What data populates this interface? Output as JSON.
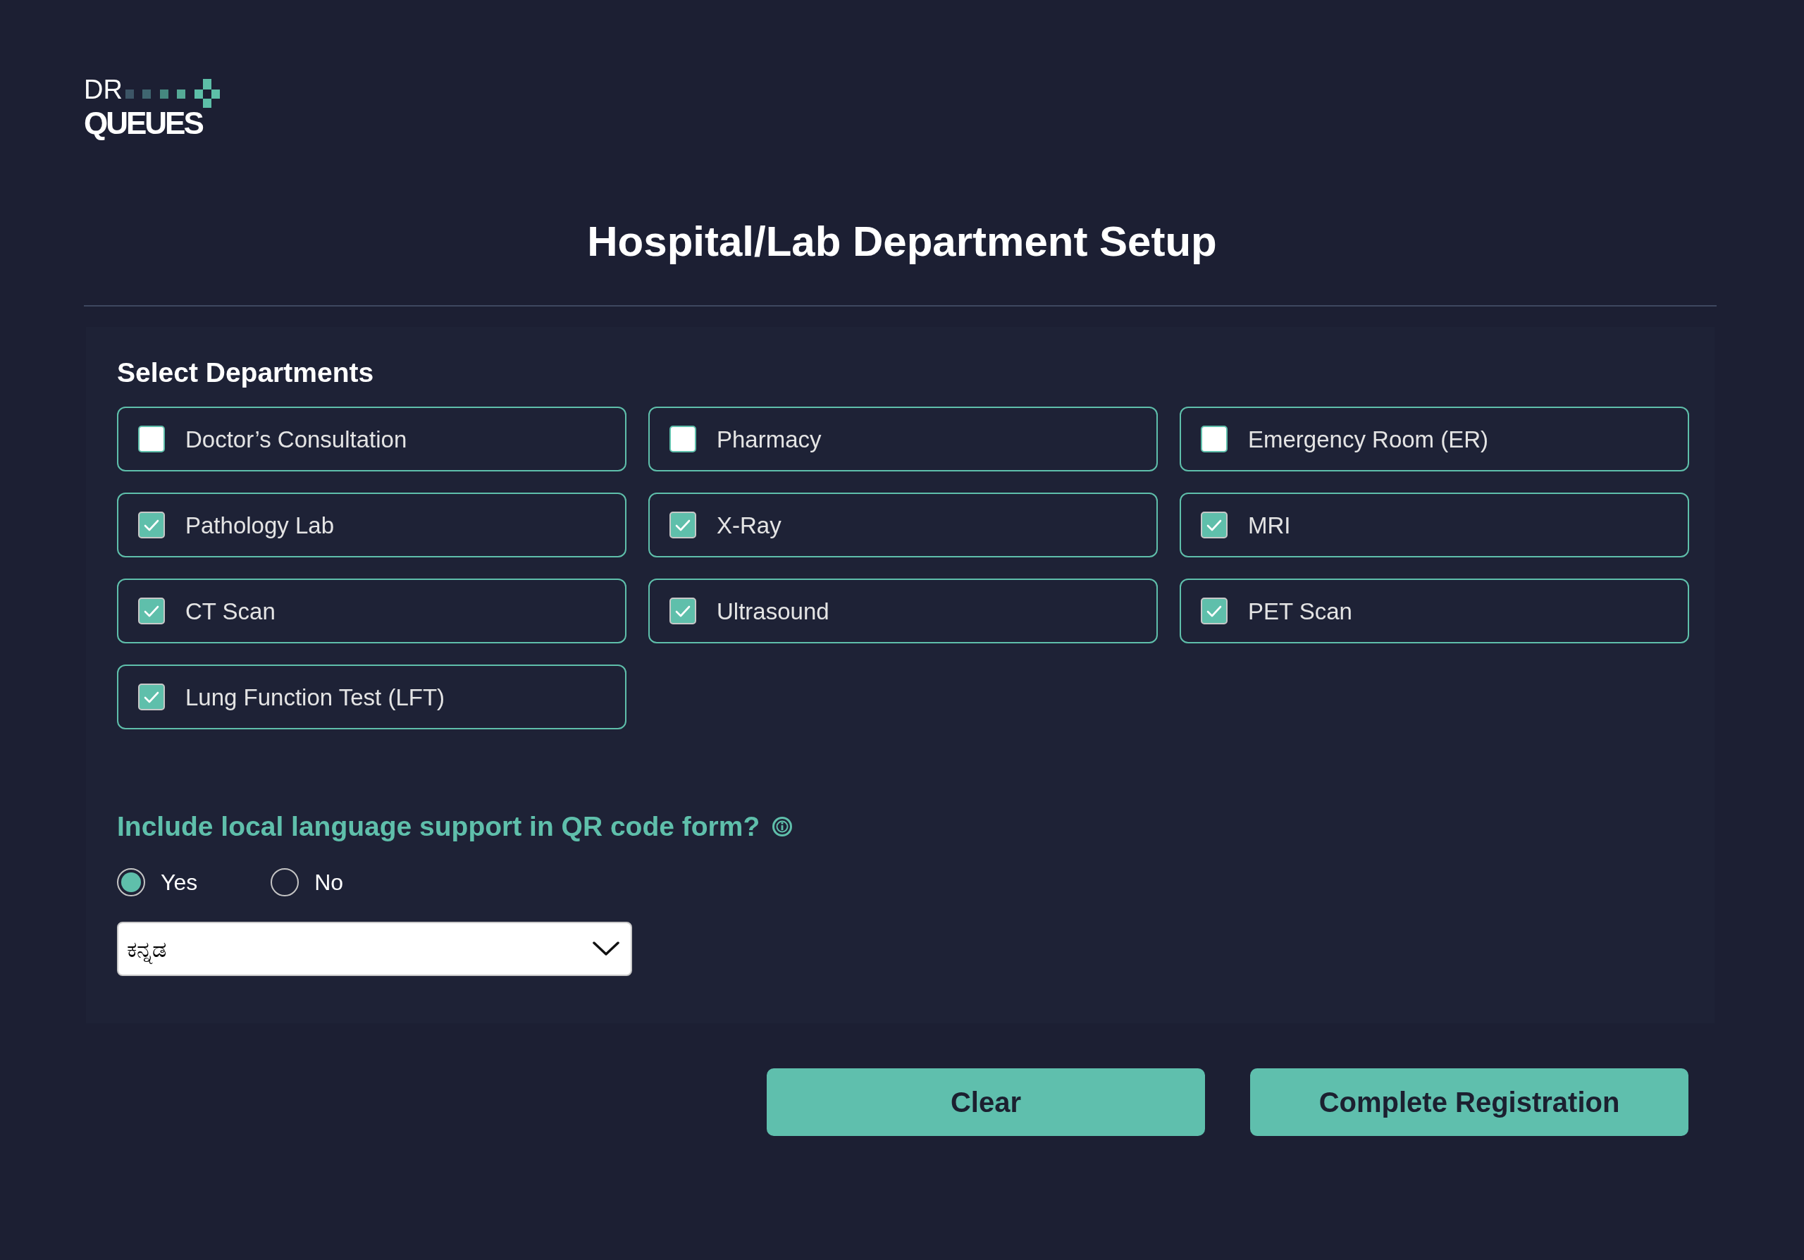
{
  "logo": {
    "line_1": "DR",
    "line_2": "QUEUES"
  },
  "title": "Hospital/Lab Department Setup",
  "departments": {
    "heading": "Select Departments",
    "items": [
      {
        "label": "Doctor’s Consultation",
        "checked": false
      },
      {
        "label": "Pharmacy",
        "checked": false
      },
      {
        "label": "Emergency Room (ER)",
        "checked": false
      },
      {
        "label": "Pathology Lab",
        "checked": true
      },
      {
        "label": "X-Ray",
        "checked": true
      },
      {
        "label": "MRI",
        "checked": true
      },
      {
        "label": "CT Scan",
        "checked": true
      },
      {
        "label": "Ultrasound",
        "checked": true
      },
      {
        "label": "PET Scan",
        "checked": true
      },
      {
        "label": "Lung Function Test (LFT)",
        "checked": true
      }
    ]
  },
  "language_support": {
    "question": "Include local language support in QR code form?",
    "options": [
      {
        "label": "Yes",
        "selected": true
      },
      {
        "label": "No",
        "selected": false
      }
    ],
    "language": {
      "value": "ಕನ್ನಡ"
    }
  },
  "buttons": [
    "Clear",
    "Complete Registration"
  ]
}
